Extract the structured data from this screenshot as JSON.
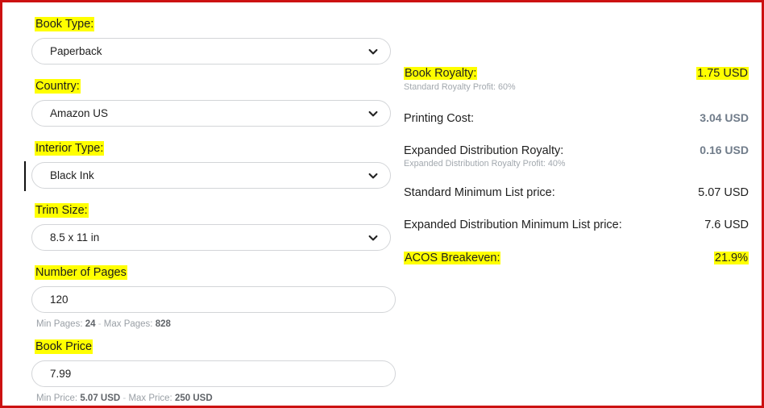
{
  "window": {
    "border_color": "#cc1111",
    "highlight_color": "#ffff00",
    "background": "#ffffff"
  },
  "form": {
    "fields": [
      {
        "label": "Book Type:",
        "value": "Paperback",
        "control": "select",
        "icon": "chevron-down-icon",
        "highlighted_label": true
      },
      {
        "label": "Country:",
        "value": "Amazon US",
        "control": "select",
        "icon": "chevron-down-icon",
        "highlighted_label": true
      },
      {
        "label": "Interior Type:",
        "value": "Black Ink",
        "control": "select",
        "icon": "chevron-down-icon",
        "highlighted_label": true,
        "focused": true
      },
      {
        "label": "Trim Size:",
        "value": "8.5 x 11 in",
        "control": "select",
        "icon": "chevron-down-icon",
        "highlighted_label": true
      },
      {
        "label": "Number of Pages",
        "value": "120",
        "control": "text",
        "highlighted_label": true,
        "hint": {
          "min_label": "Min Pages:",
          "min_value": "24",
          "separator": "-",
          "max_label": "Max Pages:",
          "max_value": "828"
        }
      },
      {
        "label": "Book Price",
        "value": "7.99",
        "control": "text",
        "highlighted_label": true,
        "hint": {
          "min_label": "Min Price:",
          "min_value": "5.07 USD",
          "separator": "-",
          "max_label": "Max Price:",
          "max_value": "250 USD"
        }
      }
    ]
  },
  "summary": {
    "rows": [
      {
        "label": "Book Royalty:",
        "value": "1.75 USD",
        "sub": "Standard Royalty Profit: 60%",
        "label_highlighted": true,
        "value_highlighted": true,
        "value_muted": false
      },
      {
        "label": "Printing Cost:",
        "value": "3.04 USD",
        "sub": "",
        "label_highlighted": false,
        "value_highlighted": false,
        "value_muted": true
      },
      {
        "label": "Expanded Distribution Royalty:",
        "value": "0.16 USD",
        "sub": "Expanded Distribution Royalty Profit: 40%",
        "label_highlighted": false,
        "value_highlighted": false,
        "value_muted": true
      },
      {
        "label": "Standard Minimum List price:",
        "value": "5.07 USD",
        "sub": "",
        "label_highlighted": false,
        "value_highlighted": false,
        "value_muted": false
      },
      {
        "label": "Expanded Distribution Minimum List price:",
        "value": "7.6 USD",
        "sub": "",
        "label_highlighted": false,
        "value_highlighted": false,
        "value_muted": false
      },
      {
        "label": "ACOS Breakeven:",
        "value": "21.9%",
        "sub": "",
        "label_highlighted": true,
        "value_highlighted": true,
        "value_muted": false
      }
    ]
  }
}
